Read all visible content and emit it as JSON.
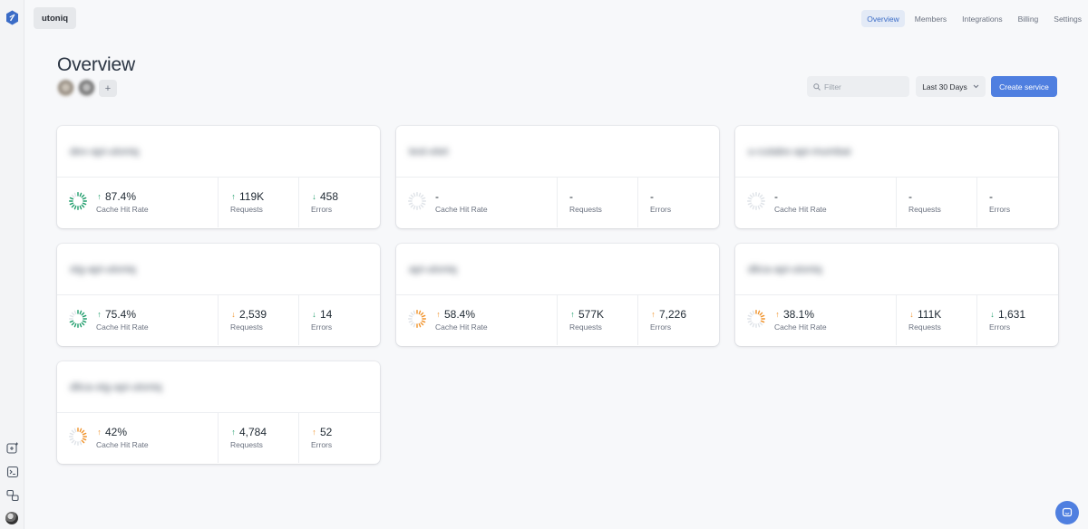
{
  "org": {
    "name": "utoniq"
  },
  "nav": [
    {
      "label": "Overview",
      "active": true
    },
    {
      "label": "Members",
      "active": false
    },
    {
      "label": "Integrations",
      "active": false
    },
    {
      "label": "Billing",
      "active": false
    },
    {
      "label": "Settings",
      "active": false
    }
  ],
  "page": {
    "title": "Overview",
    "add_member_label": "+"
  },
  "toolbar": {
    "filter_placeholder": "Filter",
    "range_label": "Last 30 Days",
    "create_label": "Create service"
  },
  "stat_labels": {
    "cache": "Cache Hit Rate",
    "requests": "Requests",
    "errors": "Errors"
  },
  "services": [
    {
      "name": "dev-api-utoniq",
      "cache": {
        "value": "87.4%",
        "trend": "up",
        "ratio": 0.874,
        "color": "#1f9d6b"
      },
      "requests": {
        "value": "119K",
        "trend": "up"
      },
      "errors": {
        "value": "458",
        "trend": "down"
      }
    },
    {
      "name": "test-etet",
      "cache": {
        "value": "-",
        "trend": "none",
        "ratio": 0,
        "color": "#c9ced6"
      },
      "requests": {
        "value": "-",
        "trend": "none"
      },
      "errors": {
        "value": "-",
        "trend": "none"
      }
    },
    {
      "name": "u-cutabo-api-mumbai",
      "cache": {
        "value": "-",
        "trend": "none",
        "ratio": 0,
        "color": "#c9ced6"
      },
      "requests": {
        "value": "-",
        "trend": "none"
      },
      "errors": {
        "value": "-",
        "trend": "none"
      }
    },
    {
      "name": "stg-api-utoniq",
      "cache": {
        "value": "75.4%",
        "trend": "up",
        "ratio": 0.754,
        "color": "#1f9d6b"
      },
      "requests": {
        "value": "2,539",
        "trend": "down"
      },
      "errors": {
        "value": "14",
        "trend": "down"
      }
    },
    {
      "name": "api-utoniq",
      "cache": {
        "value": "58.4%",
        "trend": "up",
        "ratio": 0.584,
        "color": "#f0932b"
      },
      "requests": {
        "value": "577K",
        "trend": "up"
      },
      "errors": {
        "value": "7,226",
        "trend": "up"
      }
    },
    {
      "name": "dlica-api-utoniq",
      "cache": {
        "value": "38.1%",
        "trend": "up",
        "ratio": 0.381,
        "color": "#f0932b"
      },
      "requests": {
        "value": "111K",
        "trend": "down"
      },
      "errors": {
        "value": "1,631",
        "trend": "down"
      }
    },
    {
      "name": "dlica-stg-api-utoniq",
      "cache": {
        "value": "42%",
        "trend": "up",
        "ratio": 0.42,
        "color": "#f0932b"
      },
      "requests": {
        "value": "4,784",
        "trend": "up"
      },
      "errors": {
        "value": "52",
        "trend": "up"
      }
    }
  ],
  "icons": {
    "logo": "fastly-logo-icon",
    "new_service": "add-square-icon",
    "terminal": "terminal-icon",
    "accounts": "switch-accounts-icon",
    "chat": "chat-bubble-icon",
    "search": "search-icon",
    "chevron": "chevron-down-icon"
  }
}
